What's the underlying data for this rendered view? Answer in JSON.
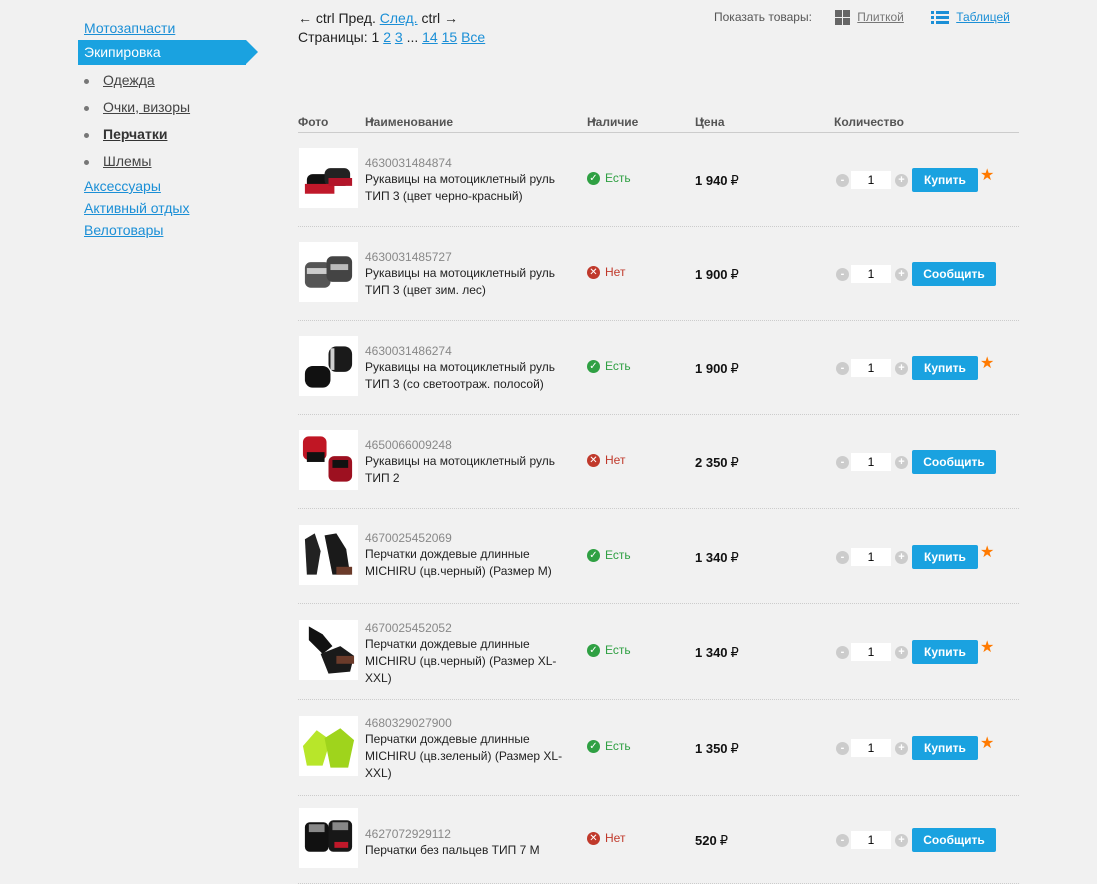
{
  "sidebar": {
    "links_top": [
      "Мотозапчасти"
    ],
    "active": "Экипировка",
    "sub": [
      "Одежда",
      "Очки, визоры",
      "Перчатки",
      "Шлемы"
    ],
    "links_bottom": [
      "Аксессуары",
      "Активный отдых",
      "Велотовары"
    ]
  },
  "pager": {
    "prev_arrow": "← ctrl",
    "prev": "Пред.",
    "next": "След.",
    "next_arrow": "ctrl →",
    "pages_label": "Страницы:",
    "current": "1",
    "pages": [
      "2",
      "3"
    ],
    "ellipsis": "...",
    "pages_tail": [
      "14",
      "15"
    ],
    "all": "Все"
  },
  "view": {
    "label": "Показать товары:",
    "tiles": "Плиткой",
    "table": "Таблицей"
  },
  "table": {
    "headers": {
      "photo": "Фото",
      "name": "Наименование",
      "avail": "Наличие",
      "price": "Цена",
      "qty": "Количество"
    }
  },
  "currency": "₽",
  "labels": {
    "buy": "Купить",
    "notify": "Сообщить",
    "minus": "-",
    "plus": "+",
    "star": "★",
    "yes_mark": "✓",
    "no_mark": "✕"
  },
  "colors": {
    "accent": "#1aa2e0",
    "in_stock": "#2fa043",
    "out_of_stock": "#c0392b",
    "star": "#ff7a00"
  },
  "products": [
    {
      "sku": "4630031484874",
      "name": "Рукавицы на мотоциклетный руль ТИП 3 (цвет черно-красный)",
      "avail": "Есть",
      "in_stock": true,
      "price": "1 940",
      "qty": "1",
      "button": "Купить",
      "star": true
    },
    {
      "sku": "4630031485727",
      "name": "Рукавицы на мотоциклетный руль ТИП 3 (цвет зим. лес)",
      "avail": "Нет",
      "in_stock": false,
      "price": "1 900",
      "qty": "1",
      "button": "Сообщить",
      "star": false
    },
    {
      "sku": "4630031486274",
      "name": "Рукавицы на мотоциклетный руль ТИП 3 (со светоотраж. полосой)",
      "avail": "Есть",
      "in_stock": true,
      "price": "1 900",
      "qty": "1",
      "button": "Купить",
      "star": true
    },
    {
      "sku": "4650066009248",
      "name": "Рукавицы на мотоциклетный руль ТИП 2",
      "avail": "Нет",
      "in_stock": false,
      "price": "2 350",
      "qty": "1",
      "button": "Сообщить",
      "star": false
    },
    {
      "sku": "4670025452069",
      "name": "Перчатки дождевые длинные MICHIRU (цв.черный) (Размер M)",
      "avail": "Есть",
      "in_stock": true,
      "price": "1 340",
      "qty": "1",
      "button": "Купить",
      "star": true
    },
    {
      "sku": "4670025452052",
      "name": "Перчатки дождевые длинные MICHIRU (цв.черный) (Размер XL-XXL)",
      "avail": "Есть",
      "in_stock": true,
      "price": "1 340",
      "qty": "1",
      "button": "Купить",
      "star": true
    },
    {
      "sku": "4680329027900",
      "name": "Перчатки дождевые длинные MICHIRU (цв.зеленый) (Размер XL-XXL)",
      "avail": "Есть",
      "in_stock": true,
      "price": "1 350",
      "qty": "1",
      "button": "Купить",
      "star": true
    },
    {
      "sku": "4627072929112",
      "name": "Перчатки без пальцев ТИП 7 M",
      "avail": "Нет",
      "in_stock": false,
      "price": "520",
      "qty": "1",
      "button": "Сообщить",
      "star": false
    }
  ]
}
